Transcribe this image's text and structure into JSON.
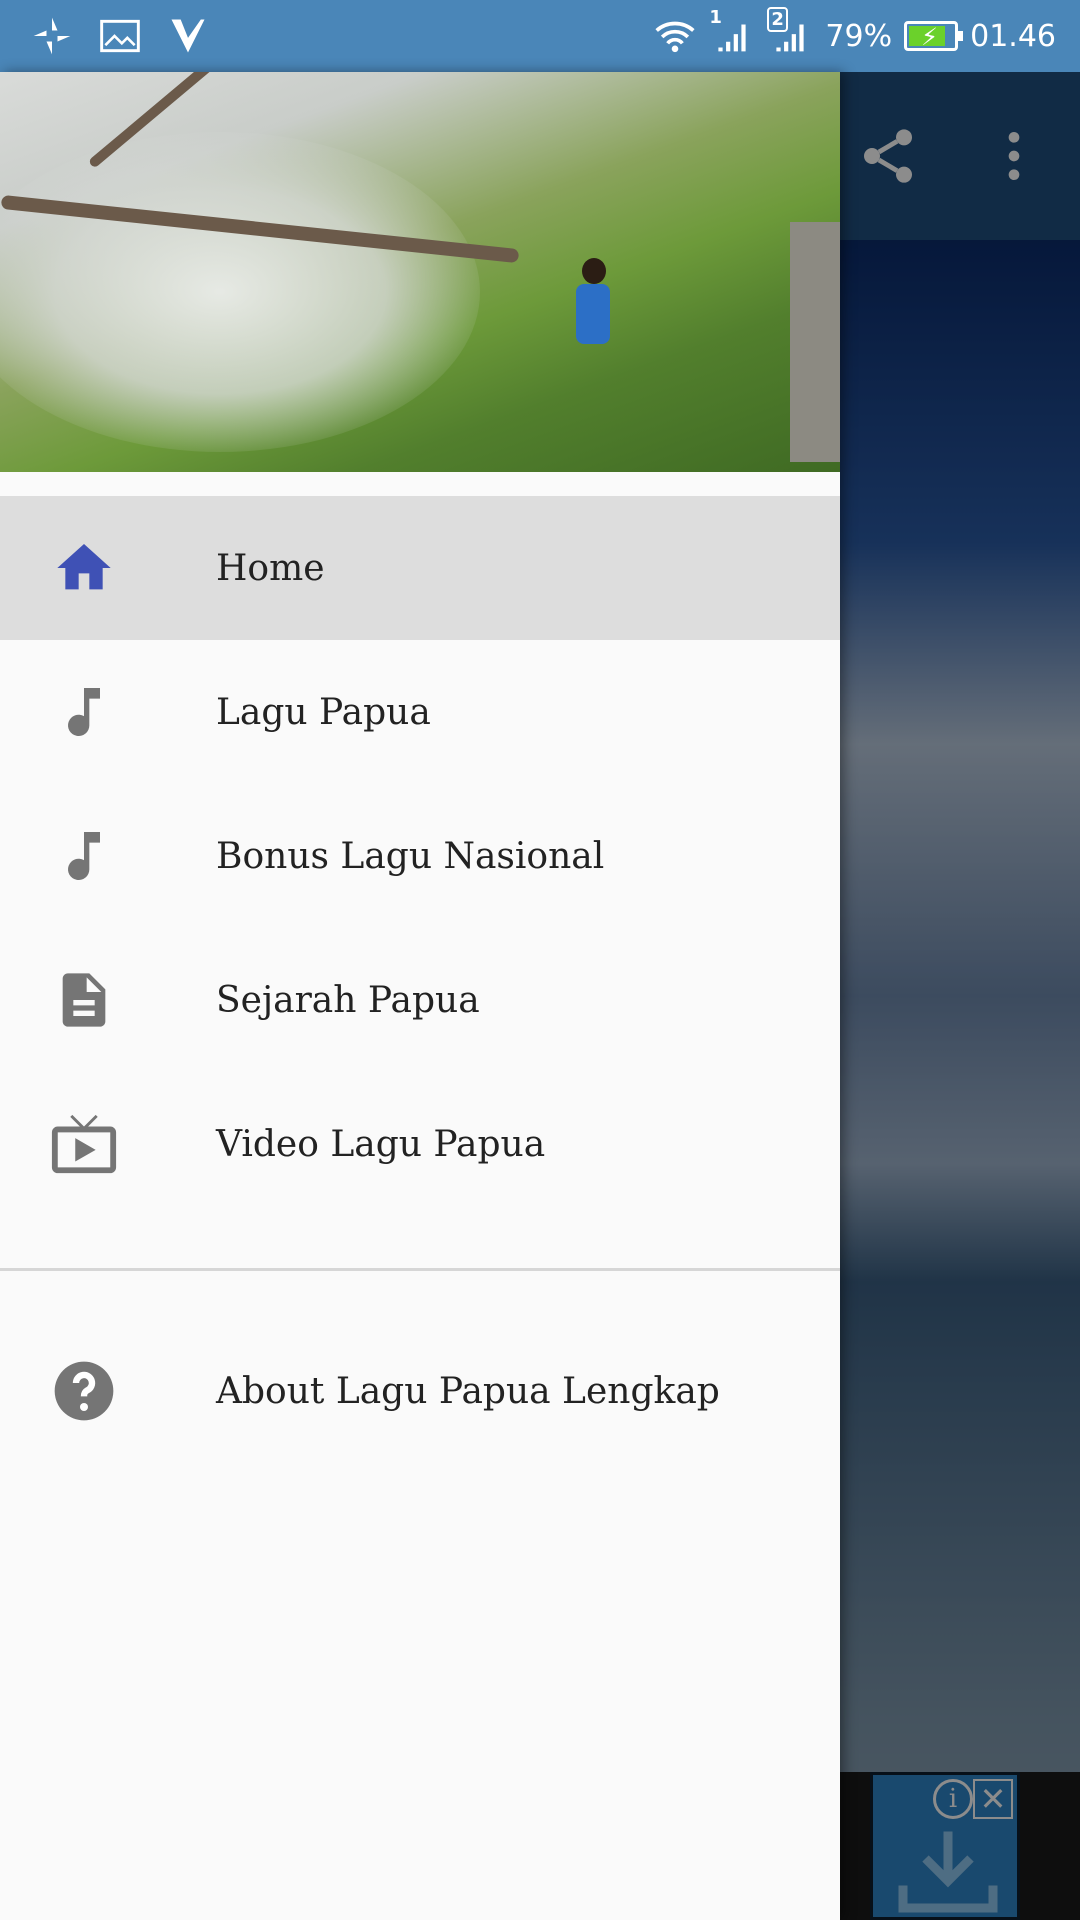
{
  "status_bar": {
    "battery": "79%",
    "time": "01.46",
    "battery_level": 0.79,
    "sim1": "1",
    "sim2": "2"
  },
  "drawer": {
    "items": [
      {
        "label": "Home",
        "icon": "home-icon",
        "active": true
      },
      {
        "label": "Lagu Papua",
        "icon": "music-note-icon"
      },
      {
        "label": "Bonus Lagu Nasional",
        "icon": "music-note-icon"
      },
      {
        "label": "Sejarah Papua",
        "icon": "document-icon"
      },
      {
        "label": "Video Lagu Papua",
        "icon": "tv-play-icon"
      }
    ],
    "about": {
      "label": "About Lagu Papua Lengkap",
      "icon": "help-icon"
    }
  },
  "colors": {
    "status_bar": "#4a86b8",
    "active_icon": "#3f51b5",
    "icon_gray": "#757575"
  }
}
